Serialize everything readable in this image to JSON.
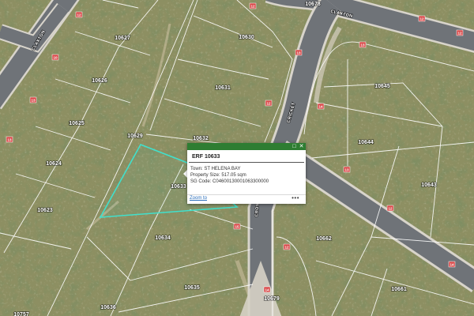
{
  "map": {
    "lot_numbers": [
      "10627",
      "10630",
      "10678",
      "10626",
      "10631",
      "10625",
      "10629",
      "10632",
      "10645",
      "10644",
      "10624",
      "10633",
      "10643",
      "10623",
      "10634",
      "10662",
      "10635",
      "10679",
      "10636",
      "10661",
      "10757"
    ],
    "street_names": [
      "CLAXTON",
      "CLAXTON",
      "CRICKET",
      "CROSS"
    ],
    "badges": [
      "12",
      "10",
      "13",
      "13",
      "12",
      "13",
      "12",
      "12",
      "12",
      "13",
      "14",
      "15",
      "12",
      "14",
      "13",
      "12",
      "14"
    ]
  },
  "popup": {
    "title": "ERF 10633",
    "town_label": "Town:",
    "town_value": "ST HELENA BAY",
    "size_label": "Property Size:",
    "size_value": "517.05 sqm",
    "sg_label": "SG Code:",
    "sg_value": "C04600130001063300000",
    "zoom_link": "Zoom to",
    "more_icon": "•••",
    "minimize_icon": "□",
    "close_icon": "✕",
    "accent_color": "#2e7d32"
  },
  "colors": {
    "selected_parcel": "#41e0cc",
    "parcel_lines": "#ffffff",
    "road": "#6f7378",
    "badge": "#d94a4a"
  }
}
